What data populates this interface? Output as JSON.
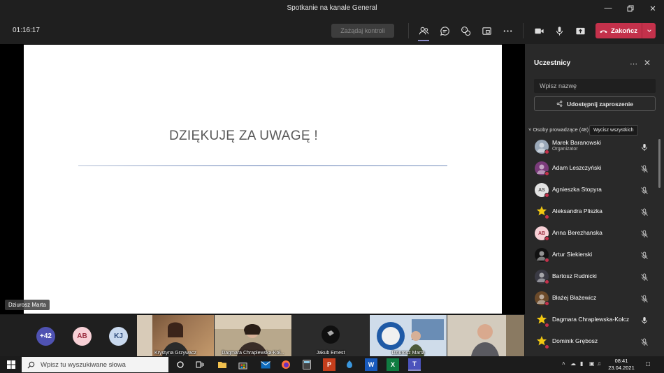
{
  "window": {
    "title": "Spotkanie na kanale General",
    "controls": [
      "minimize-icon",
      "restore-icon",
      "close-icon"
    ]
  },
  "toolbar": {
    "timer": "01:16:17",
    "request_control": "Zażądaj kontroli",
    "icons": [
      "participants-icon",
      "chat-icon",
      "reactions-icon",
      "rooms-icon",
      "more-icon",
      "camera-icon",
      "microphone-icon",
      "share-screen-icon"
    ],
    "end_label": "Zakończ",
    "colors": {
      "end_button": "#c4314b",
      "active_underline": "#8b8cc7"
    }
  },
  "stage": {
    "slide_text": "DZIĘKUJĘ ZA UWAGĘ !",
    "presenter_name": "Dziurosz Marta"
  },
  "strip": {
    "avatars": [
      {
        "text": "+42",
        "bg": "#4f52b2",
        "fg": "#ffffff"
      },
      {
        "text": "AB",
        "bg": "#f7d0d6",
        "fg": "#9a2d3f"
      },
      {
        "text": "KJ",
        "bg": "#c9d9ee",
        "fg": "#2d4a7a"
      }
    ],
    "tiles": [
      {
        "name": "Krystyna Grzywacz"
      },
      {
        "name": "Dagmara Chraplewska-Koł..."
      },
      {
        "name": "Jakub Ernest"
      },
      {
        "name": "Dziurosz Marta"
      },
      {
        "name": ""
      }
    ]
  },
  "panel": {
    "title": "Uczestnicy",
    "search_placeholder": "Wpisz nazwę",
    "share_label": "Udostępnij zaproszenie",
    "group_label": "Osoby prowadzące (48)",
    "tooltip": "Wycisz wszystkich",
    "people": [
      {
        "name": "Marek Baranowski",
        "role": "Organizator",
        "avatar": "",
        "avatar_bg": "#9aa8b8",
        "avatar_fg": "#ffffff",
        "muted": false
      },
      {
        "name": "Adam Leszczyński",
        "role": "",
        "avatar": "",
        "avatar_bg": "#7a3b7a",
        "avatar_fg": "#ffffff",
        "muted": true
      },
      {
        "name": "Agnieszka Stopyra",
        "role": "",
        "avatar": "AS",
        "avatar_bg": "#e3e3e3",
        "avatar_fg": "#555555",
        "muted": true
      },
      {
        "name": "Aleksandra Pliszka",
        "role": "",
        "avatar": "",
        "avatar_bg": "#292929",
        "avatar_fg": "#f2c811",
        "muted": true
      },
      {
        "name": "Anna Berezhanska",
        "role": "",
        "avatar": "AB",
        "avatar_bg": "#f7d0d6",
        "avatar_fg": "#9a2d3f",
        "muted": true
      },
      {
        "name": "Artur Siekierski",
        "role": "",
        "avatar": "",
        "avatar_bg": "#111111",
        "avatar_fg": "#ffffff",
        "muted": true
      },
      {
        "name": "Bartosz Rudnicki",
        "role": "",
        "avatar": "",
        "avatar_bg": "#3a3a44",
        "avatar_fg": "#ffffff",
        "muted": true
      },
      {
        "name": "Błażej Błażewicz",
        "role": "",
        "avatar": "",
        "avatar_bg": "#6b4a2a",
        "avatar_fg": "#ffffff",
        "muted": true
      },
      {
        "name": "Dagmara Chraplewska-Kołcz",
        "role": "",
        "avatar": "",
        "avatar_bg": "#292929",
        "avatar_fg": "#f2c811",
        "muted": false
      },
      {
        "name": "Dominik Grębosz",
        "role": "",
        "avatar": "",
        "avatar_bg": "#292929",
        "avatar_fg": "#f2c811",
        "muted": true
      }
    ]
  },
  "taskbar": {
    "search_placeholder": "Wpisz tu wyszukiwane słowa",
    "time": "08:41",
    "date": "23.04.2021",
    "apps": [
      "task-view-icon",
      "widgets-icon",
      "explorer-icon",
      "store-icon",
      "mail-icon",
      "firefox-icon",
      "calculator-icon",
      "powerpoint-icon",
      "folder-icon",
      "word-icon",
      "excel-icon",
      "teams-icon"
    ]
  }
}
